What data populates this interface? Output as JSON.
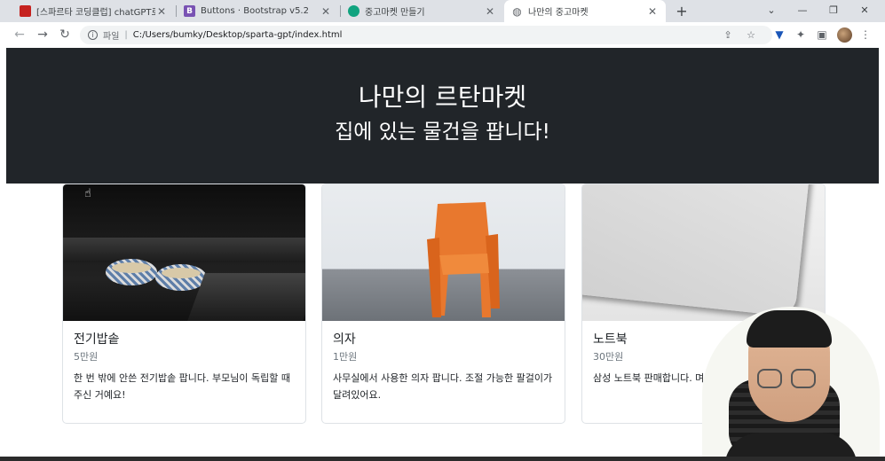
{
  "browser": {
    "tabs": [
      {
        "title": "[스파르타 코딩클럽] chatGPT로 ",
        "favicon": "book-icon",
        "favicon_color": "#c5221f"
      },
      {
        "title": "Buttons · Bootstrap v5.2",
        "favicon": "bootstrap-icon",
        "favicon_color": "#7952b3",
        "favicon_letter": "B"
      },
      {
        "title": "중고마켓 만들기",
        "favicon": "openai-icon",
        "favicon_color": "#10a37f"
      },
      {
        "title": "나만의 중고마켓",
        "favicon": "globe-icon",
        "favicon_color": "#5f6368",
        "active": true
      }
    ],
    "address": {
      "scheme_label": "파일",
      "url": "C:/Users/bumky/Desktop/sparta-gpt/index.html"
    }
  },
  "hero": {
    "title": "나만의 르탄마켓",
    "subtitle": "집에 있는 물건을 팝니다!",
    "background": "#212529"
  },
  "cards": [
    {
      "title": "전기밥솥",
      "price": "5만원",
      "desc": "한 번 밖에 안쓴 전기밥솥 팝니다. 부모님이 독립할 때 주신 거예요!"
    },
    {
      "title": "의자",
      "price": "1만원",
      "desc": "사무실에서 사용한 의자 팝니다. 조절 가능한 팔걸이가 달려있어요."
    },
    {
      "title": "노트북",
      "price": "30만원",
      "desc": "삼성 노트북 판매합니다. 며, 상태는 깨끗합니다."
    }
  ]
}
